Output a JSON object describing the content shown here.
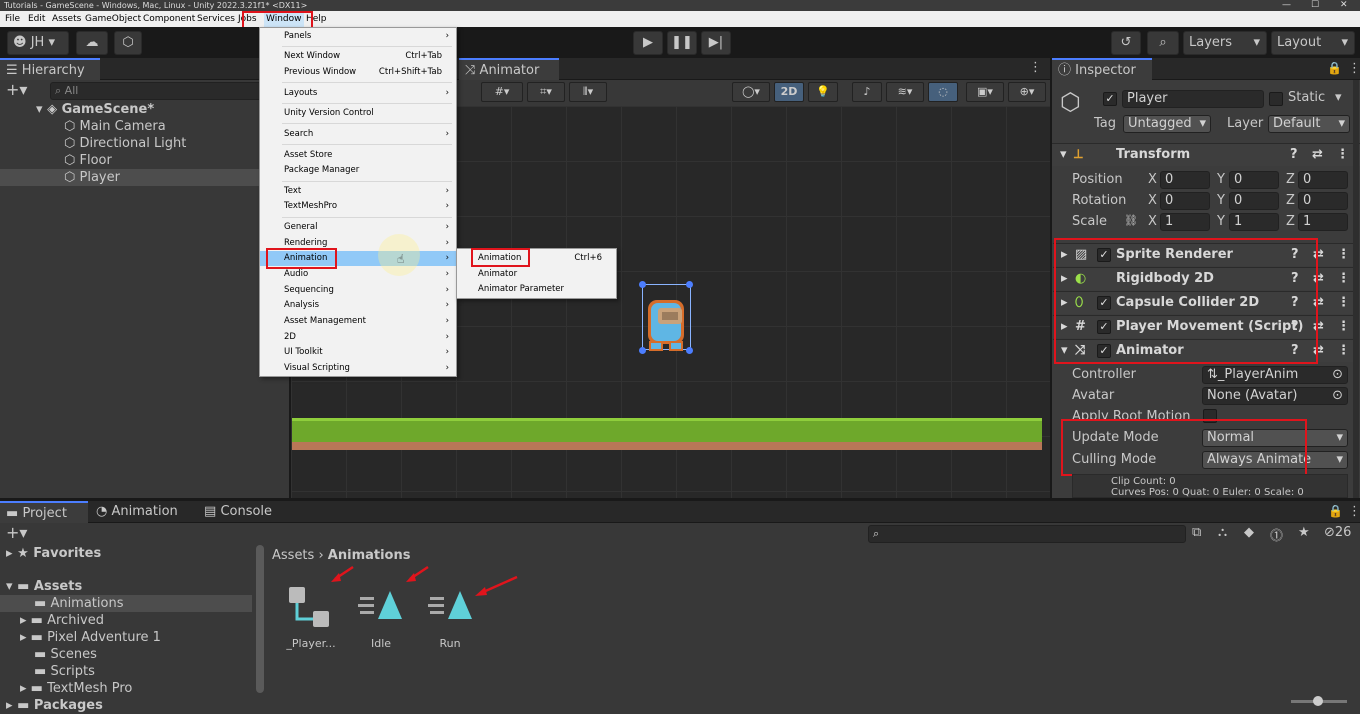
{
  "window": {
    "title": "Tutorials - GameScene - Windows, Mac, Linux - Unity 2022.3.21f1* <DX11>"
  },
  "menubar": [
    "File",
    "Edit",
    "Assets",
    "GameObject",
    "Component",
    "Services",
    "Jobs",
    "Window",
    "Help"
  ],
  "toolbar": {
    "account": "JH",
    "layers": "Layers",
    "layout": "Layout"
  },
  "hierarchy": {
    "tab": "Hierarchy",
    "search_placeholder": "All",
    "scene": "GameScene*",
    "items": [
      "Main Camera",
      "Directional Light",
      "Floor",
      "Player"
    ]
  },
  "animator": {
    "tab": "Animator",
    "mode_2d": "2D"
  },
  "window_menu": {
    "items": [
      "Panels",
      "Next Window",
      "Previous Window",
      "Layouts",
      "Unity Version Control",
      "Search",
      "Asset Store",
      "Package Manager",
      "Text",
      "TextMeshPro",
      "General",
      "Rendering",
      "Animation",
      "Audio",
      "Sequencing",
      "Analysis",
      "Asset Management",
      "2D",
      "UI Toolkit",
      "Visual Scripting"
    ],
    "shortcuts": {
      "next_window": "Ctrl+Tab",
      "previous_window": "Ctrl+Shift+Tab"
    }
  },
  "animation_submenu": {
    "items": [
      "Animation",
      "Animator",
      "Animator Parameter"
    ],
    "shortcut": "Ctrl+6"
  },
  "inspector": {
    "tab": "Inspector",
    "object_name": "Player",
    "static_label": "Static",
    "tag_label": "Tag",
    "tag_value": "Untagged",
    "layer_label": "Layer",
    "layer_value": "Default",
    "transform": {
      "title": "Transform",
      "position_label": "Position",
      "rotation_label": "Rotation",
      "scale_label": "Scale",
      "position": [
        "0",
        "0",
        "0"
      ],
      "rotation": [
        "0",
        "0",
        "0"
      ],
      "scale": [
        "1",
        "1",
        "1"
      ],
      "axes": [
        "X",
        "Y",
        "Z"
      ]
    },
    "components": [
      "Sprite Renderer",
      "Rigidbody 2D",
      "Capsule Collider 2D",
      "Player Movement (Script)",
      "Animator"
    ],
    "animator_fields": {
      "controller_label": "Controller",
      "controller_value": "_PlayerAnim",
      "avatar_label": "Avatar",
      "avatar_value": "None (Avatar)",
      "root_motion_label": "Apply Root Motion",
      "update_mode_label": "Update Mode",
      "update_mode_value": "Normal",
      "culling_mode_label": "Culling Mode",
      "culling_mode_value": "Always Animate",
      "clip_count": "Clip Count: 0",
      "curves": "Curves Pos: 0 Quat: 0 Euler: 0 Scale: 0"
    }
  },
  "bottom": {
    "tabs": [
      "Project",
      "Animation",
      "Console"
    ],
    "hidden_count": "26",
    "breadcrumb": [
      "Assets",
      "Animations"
    ],
    "favorites": "Favorites",
    "assets_root": "Assets",
    "folders": [
      "Animations",
      "Archived",
      "Pixel Adventure 1",
      "Scenes",
      "Scripts",
      "TextMesh Pro"
    ],
    "packages": "Packages",
    "assets": [
      "_Player...",
      "Idle",
      "Run"
    ]
  },
  "colors": {
    "highlight": "#e0141c",
    "menu_hover": "#91c9f7",
    "tab_accent": "#4c7eff"
  }
}
